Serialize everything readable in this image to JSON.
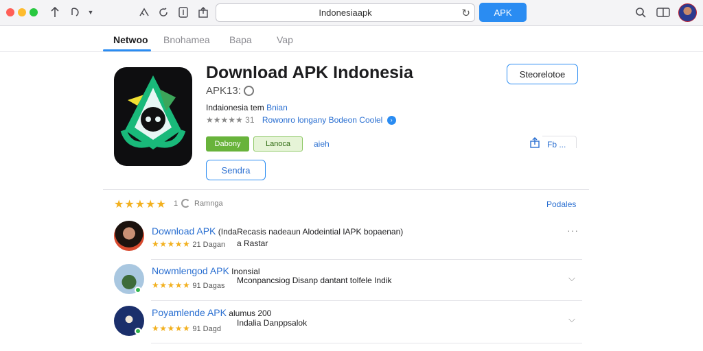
{
  "toolbar": {
    "address": "Indonesiaapk",
    "apk_button": "APK"
  },
  "tabs": [
    {
      "label": "Netwoo"
    },
    {
      "label": "Bnohamea"
    },
    {
      "label": "Bapa"
    },
    {
      "label": "Vap"
    }
  ],
  "app": {
    "title": "Download APK Indonesia",
    "subtitle": "APK13:",
    "developer_label": "Indaionesia tem",
    "developer_link": "Bnian",
    "rating_stars": "★★★★★",
    "rating_count": "31",
    "rating_link": "Rowonro longany Bodeon Coolel",
    "badge_green": "Dabony",
    "badge_light": "Lanoca",
    "badge_link": "aieh",
    "primary_button": "Sendra",
    "side_button": "Steorelotoe",
    "more_link": "Fb ..."
  },
  "reviews_summary": {
    "stars": "★★★★★",
    "count": "1",
    "label": "Ramnga",
    "link": "Podales"
  },
  "reviews": [
    {
      "title": "Download APK",
      "title_rest": " (IndaRecasis nadeaun Alodeintial IAPK bopaenan)",
      "stars": "★★★★★",
      "meta": "21 Dagan",
      "body": "a Rastar"
    },
    {
      "title": "Nowmlengod APK",
      "title_rest": " Inonsial",
      "stars": "★★★★★",
      "meta": "91 Dagas",
      "body": "Mconpancsiog Disanp dantant tolfele Indik"
    },
    {
      "title": "Poyamlende APK",
      "title_rest": " alumus 200",
      "stars": "★★★★★",
      "meta": "91 Dagd",
      "body": "Indalia Danppsalok"
    }
  ],
  "colors": {
    "accent": "#2a8cf2",
    "link": "#2a6fd1",
    "star": "#f2b01e",
    "badge_green": "#68b33b"
  }
}
